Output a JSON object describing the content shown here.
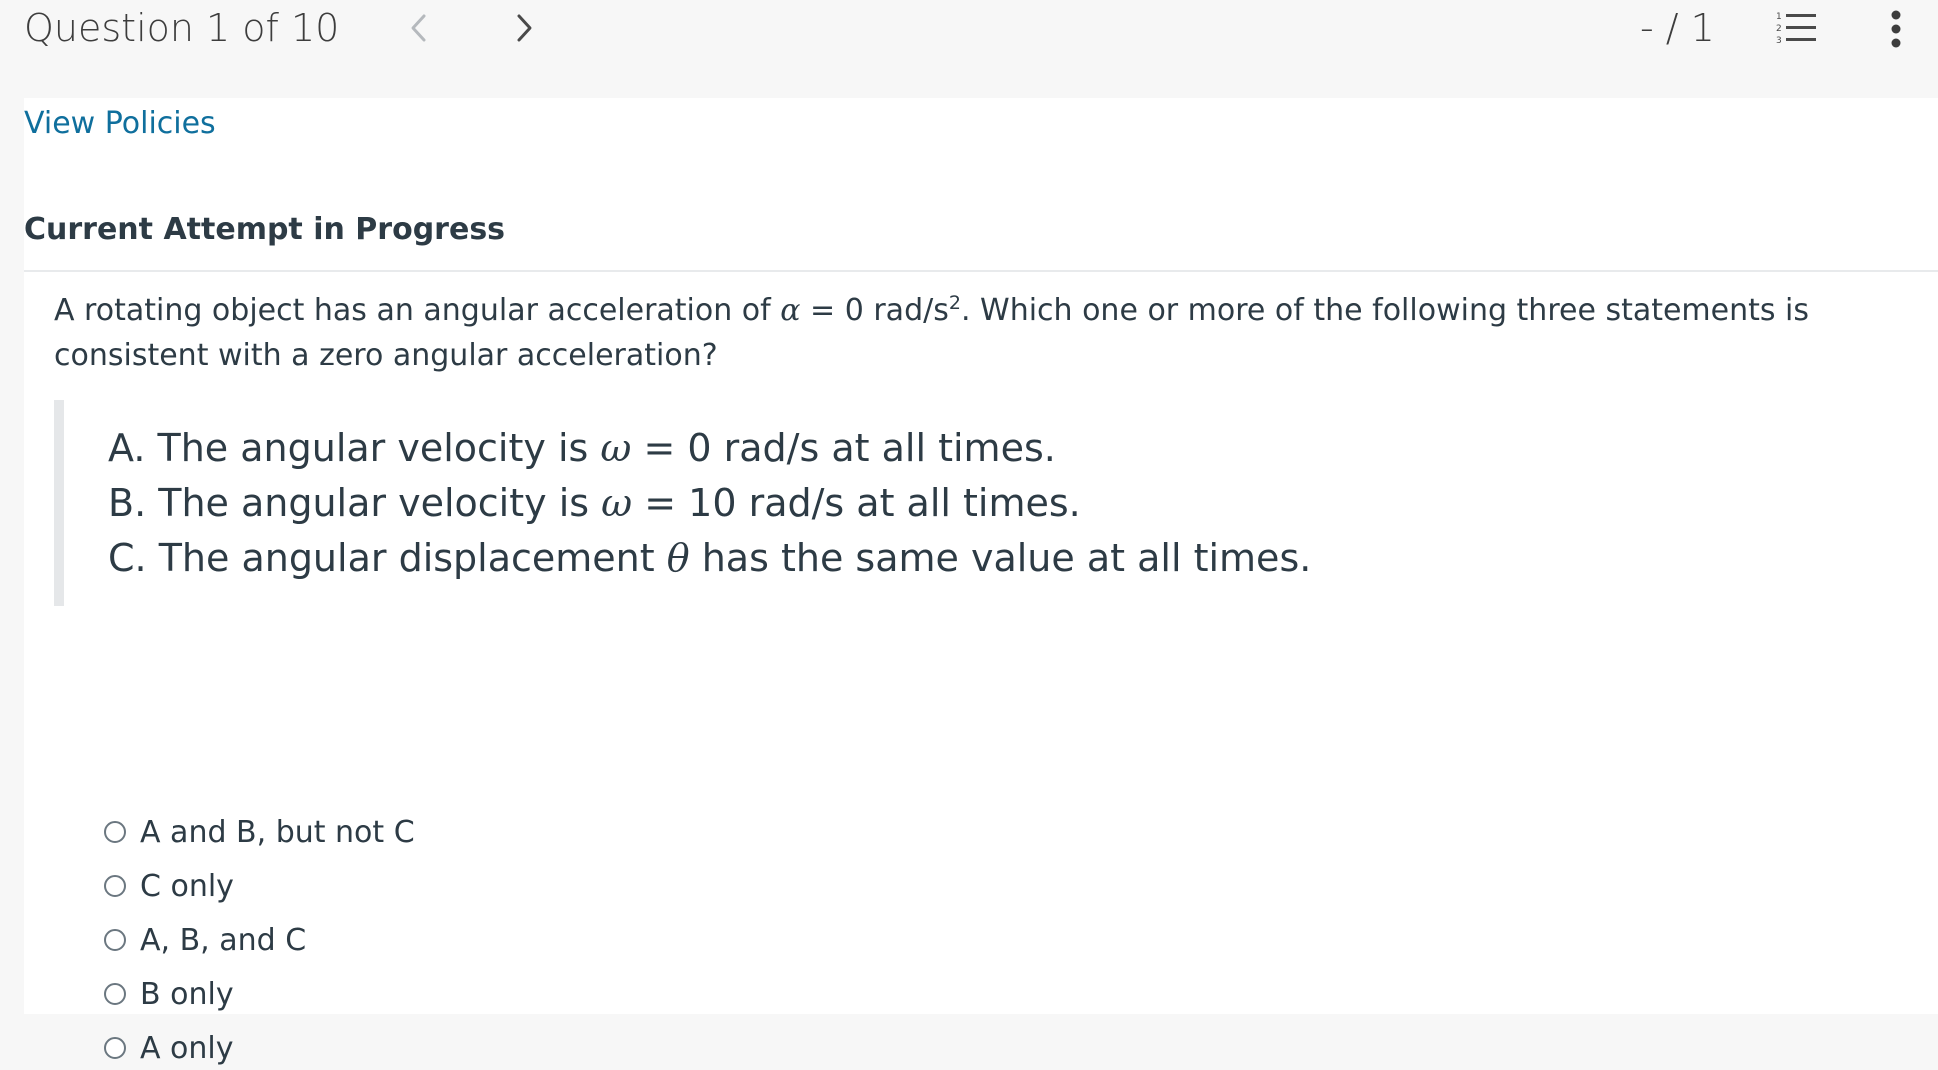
{
  "header": {
    "question_counter": "Question 1 of 10",
    "score": "- / 1",
    "prev_icon": "chevron-left-icon",
    "next_icon": "chevron-right-icon",
    "list_icon": "numbered-list-icon",
    "more_icon": "vertical-dots-icon"
  },
  "policies_link": "View Policies",
  "attempt_heading": "Current Attempt in Progress",
  "question": {
    "part1": "A rotating object has an angular acceleration of ",
    "alpha": "α",
    "part2": " = 0 rad/s",
    "exp": "2",
    "part3": ". Which one or more of the following three statements is consistent with a zero angular acceleration?"
  },
  "statements": [
    {
      "prefix": "A. The angular velocity is ",
      "symbol": "ω",
      "suffix": " = 0 rad/s at all times."
    },
    {
      "prefix": "B. The angular velocity is ",
      "symbol": "ω",
      "suffix": " = 10 rad/s at all times."
    },
    {
      "prefix": "C. The angular displacement ",
      "symbol": "θ",
      "suffix": " has the same value at all times."
    }
  ],
  "choices": [
    {
      "label": "A and B, but not C"
    },
    {
      "label": "C only"
    },
    {
      "label": "A, B, and C"
    },
    {
      "label": "B only"
    },
    {
      "label": "A only"
    }
  ],
  "colors": {
    "link": "#0f6f9d",
    "text": "#2d3b45",
    "topbar_bg": "#f7f7f7"
  }
}
